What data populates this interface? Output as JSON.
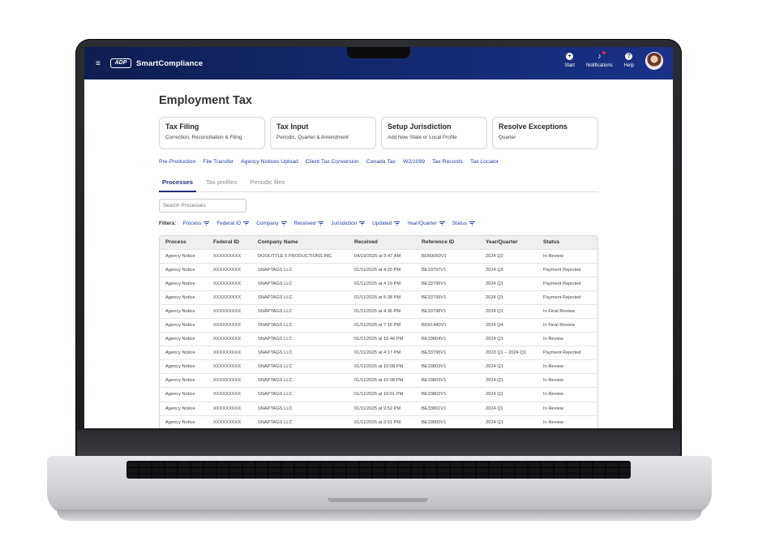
{
  "header": {
    "menu_icon": "hamburger-icon",
    "logo_text": "ADP",
    "brand": "SmartCompliance",
    "actions": [
      {
        "label": "Start",
        "icon": "plus-circle-icon",
        "glyph": "+"
      },
      {
        "label": "Notifications",
        "icon": "bell-icon",
        "glyph": "🔔"
      },
      {
        "label": "Help",
        "icon": "question-icon",
        "glyph": "?"
      }
    ],
    "colors": {
      "bar": "#14286e",
      "accent": "#2243a6"
    }
  },
  "page": {
    "title": "Employment Tax",
    "cards": [
      {
        "title": "Tax Filing",
        "subtitle": "Correction, Reconciliation & Filing"
      },
      {
        "title": "Tax Input",
        "subtitle": "Periodic, Quarter & Amendment"
      },
      {
        "title": "Setup Jurisdiction",
        "subtitle": "Add New State or Local Profile"
      },
      {
        "title": "Resolve Exceptions",
        "subtitle": "Quarter"
      }
    ],
    "quick_links": [
      "Pre-Production",
      "File Transfer",
      "Agency Notices Upload",
      "Client Tax Conversion",
      "Canada Tax",
      "W2/1099",
      "Tax Records",
      "Tax Locator"
    ],
    "tabs": [
      "Processes",
      "Tax profiles",
      "Periodic files"
    ],
    "active_tab": "Processes",
    "search_placeholder": "Search Processes",
    "filters_label": "Filters:",
    "filters": [
      "Process",
      "Federal ID",
      "Company",
      "Received",
      "Jurisdiction",
      "Updated",
      "Year/Quarter",
      "Status"
    ]
  },
  "table": {
    "columns": [
      "Process",
      "Federal ID",
      "Company Name",
      "Received",
      "Reference ID",
      "Year/Quarter",
      "Status"
    ],
    "rows": [
      [
        "Agency Notice",
        "XXXXXXXXX",
        "DOOLITTLE 5 PRODUCTIONS INC",
        "04/19/2025 at 5:47 AM",
        "BD69060V1",
        "2024 Q2",
        "In Review"
      ],
      [
        "Agency Notice",
        "XXXXXXXXX",
        "SNAPTAGS LLC",
        "01/11/2025 at 4:20 PM",
        "BE33797V1",
        "2024 Q3",
        "Payment Rejected"
      ],
      [
        "Agency Notice",
        "XXXXXXXXX",
        "SNAPTAGS LLC",
        "01/11/2025 at 4:19 PM",
        "BE33796V1",
        "2024 Q1",
        "Payment Rejected"
      ],
      [
        "Agency Notice",
        "XXXXXXXXX",
        "SNAPTAGS LLC",
        "01/11/2025 at 5:38 PM",
        "BE33799V1",
        "2024 Q1",
        "Payment Rejected"
      ],
      [
        "Agency Notice",
        "XXXXXXXXX",
        "SNAPTAGS LLC",
        "01/11/2025 at 4:36 PM",
        "BE33798V1",
        "2024 Q1",
        "In Final Review"
      ],
      [
        "Agency Notice",
        "XXXXXXXXX",
        "SNAPTAGS LLC",
        "01/11/2025 at 7:16 PM",
        "BD91440V1",
        "2024 Q4",
        "In Final Review"
      ],
      [
        "Agency Notice",
        "XXXXXXXXX",
        "SNAPTAGS LLC",
        "01/11/2025 at 10:46 PM",
        "BE33804V1",
        "2024 Q1",
        "In Review"
      ],
      [
        "Agency Notice",
        "XXXXXXXXX",
        "SNAPTAGS LLC",
        "01/11/2025 at 4:17 PM",
        "BE33795V1",
        "2023 Q1 – 2024 Q1",
        "Payment Rejected"
      ],
      [
        "Agency Notice",
        "XXXXXXXXX",
        "SNAPTAGS LLC",
        "01/11/2025 at 10:08 PM",
        "BE33803V1",
        "2024 Q1",
        "In Review"
      ],
      [
        "Agency Notice",
        "XXXXXXXXX",
        "SNAPTAGS LLC",
        "01/11/2025 at 10:08 PM",
        "BE33803V1",
        "2024 Q1",
        "In Review"
      ],
      [
        "Agency Notice",
        "XXXXXXXXX",
        "SNAPTAGS LLC",
        "01/11/2025 at 10:01 PM",
        "BE33802V1",
        "2024 Q1",
        "In Review"
      ],
      [
        "Agency Notice",
        "XXXXXXXXX",
        "SNAPTAGS LLC",
        "01/11/2025 at 9:52 PM",
        "BE33801V1",
        "2024 Q1",
        "In Review"
      ],
      [
        "Agency Notice",
        "XXXXXXXXX",
        "SNAPTAGS LLC",
        "01/11/2025 at 9:51 PM",
        "BE33800V1",
        "2024 Q1",
        "In Review"
      ]
    ]
  }
}
